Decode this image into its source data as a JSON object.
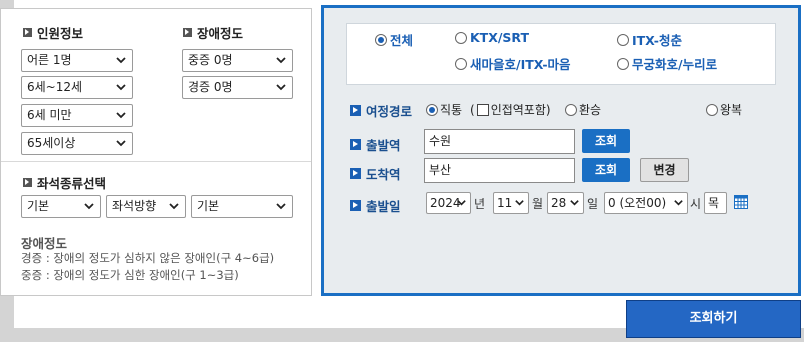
{
  "passenger": {
    "title": "인원정보",
    "adult": "어른 1명",
    "child": "6세~12세",
    "infant": "6세 미만",
    "senior": "65세이상"
  },
  "disability": {
    "title": "장애정도",
    "severe": "중증 0명",
    "mild": "경증 0명"
  },
  "seat": {
    "title": "좌석종류선택",
    "type": "기본",
    "direction": "좌석방향",
    "extra": "기본"
  },
  "note": {
    "title": "장애정도",
    "line1": "경증 : 장애의 정도가 심하지 않은 장애인(구 4~6급)",
    "line2": "중증 : 장애의 정도가 심한 장애인(구 1~3급)"
  },
  "train_types": {
    "all": "전체",
    "ktx": "KTX/SRT",
    "itx_cheongchun": "ITX-청춘",
    "saemaeul": "새마을호/ITX-마음",
    "mugunghwa": "무궁화호/누리로",
    "selected": "전체"
  },
  "trip": {
    "label": "여정경로",
    "direct": "직통",
    "nearby_open": "(",
    "nearby": "인접역포함)",
    "transfer": "환승",
    "roundtrip": "왕복"
  },
  "departure": {
    "label": "출발역",
    "value": "수원",
    "button": "조회"
  },
  "arrival": {
    "label": "도착역",
    "value": "부산",
    "button": "조회",
    "swap": "변경"
  },
  "date": {
    "label": "출발일",
    "year": "2024",
    "year_unit": "년",
    "month": "11",
    "month_unit": "월",
    "day": "28",
    "day_unit": "일",
    "hour": "0 (오전00)",
    "hour_unit": "시",
    "weekday": "목"
  },
  "search_button": "조회하기",
  "colors": {
    "accent": "#1a6fc4",
    "panel_bg": "#e8ecef",
    "bg": "#d4d4d4"
  }
}
